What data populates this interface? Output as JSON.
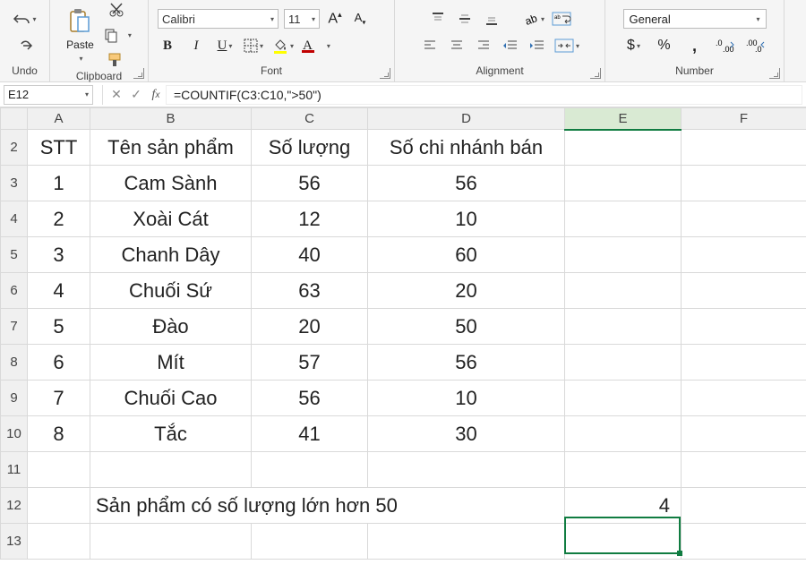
{
  "ribbon": {
    "undo": {
      "label": "Undo"
    },
    "clipboard": {
      "label": "Clipboard",
      "paste": "Paste"
    },
    "font": {
      "label": "Font",
      "name": "Calibri",
      "size": "11"
    },
    "alignment": {
      "label": "Alignment"
    },
    "number": {
      "label": "Number",
      "format": "General"
    }
  },
  "formula_bar": {
    "name_box": "E12",
    "formula": "=COUNTIF(C3:C10,\">50\")"
  },
  "columns": [
    "A",
    "B",
    "C",
    "D",
    "E",
    "F"
  ],
  "active_column": "E",
  "headers": {
    "A": "STT",
    "B": "Tên sản phẩm",
    "C": "Số lượng",
    "D": "Số chi nhánh bán"
  },
  "rows": [
    {
      "r": "2",
      "A": "STT",
      "B": "Tên sản phẩm",
      "C": "Số lượng",
      "D": "Số chi nhánh bán"
    },
    {
      "r": "3",
      "A": "1",
      "B": "Cam Sành",
      "C": "56",
      "D": "56"
    },
    {
      "r": "4",
      "A": "2",
      "B": "Xoài Cát",
      "C": "12",
      "D": "10"
    },
    {
      "r": "5",
      "A": "3",
      "B": "Chanh Dây",
      "C": "40",
      "D": "60"
    },
    {
      "r": "6",
      "A": "4",
      "B": "Chuối Sứ",
      "C": "63",
      "D": "20"
    },
    {
      "r": "7",
      "A": "5",
      "B": "Đào",
      "C": "20",
      "D": "50"
    },
    {
      "r": "8",
      "A": "6",
      "B": "Mít",
      "C": "57",
      "D": "56"
    },
    {
      "r": "9",
      "A": "7",
      "B": "Chuối Cao",
      "C": "56",
      "D": "10"
    },
    {
      "r": "10",
      "A": "8",
      "B": "Tắc",
      "C": "41",
      "D": "30"
    },
    {
      "r": "11"
    },
    {
      "r": "12",
      "B": "Sản phẩm có số lượng lớn hơn 50",
      "E": "4"
    },
    {
      "r": "13"
    }
  ],
  "selected_cell": "E12",
  "result_value": "4"
}
